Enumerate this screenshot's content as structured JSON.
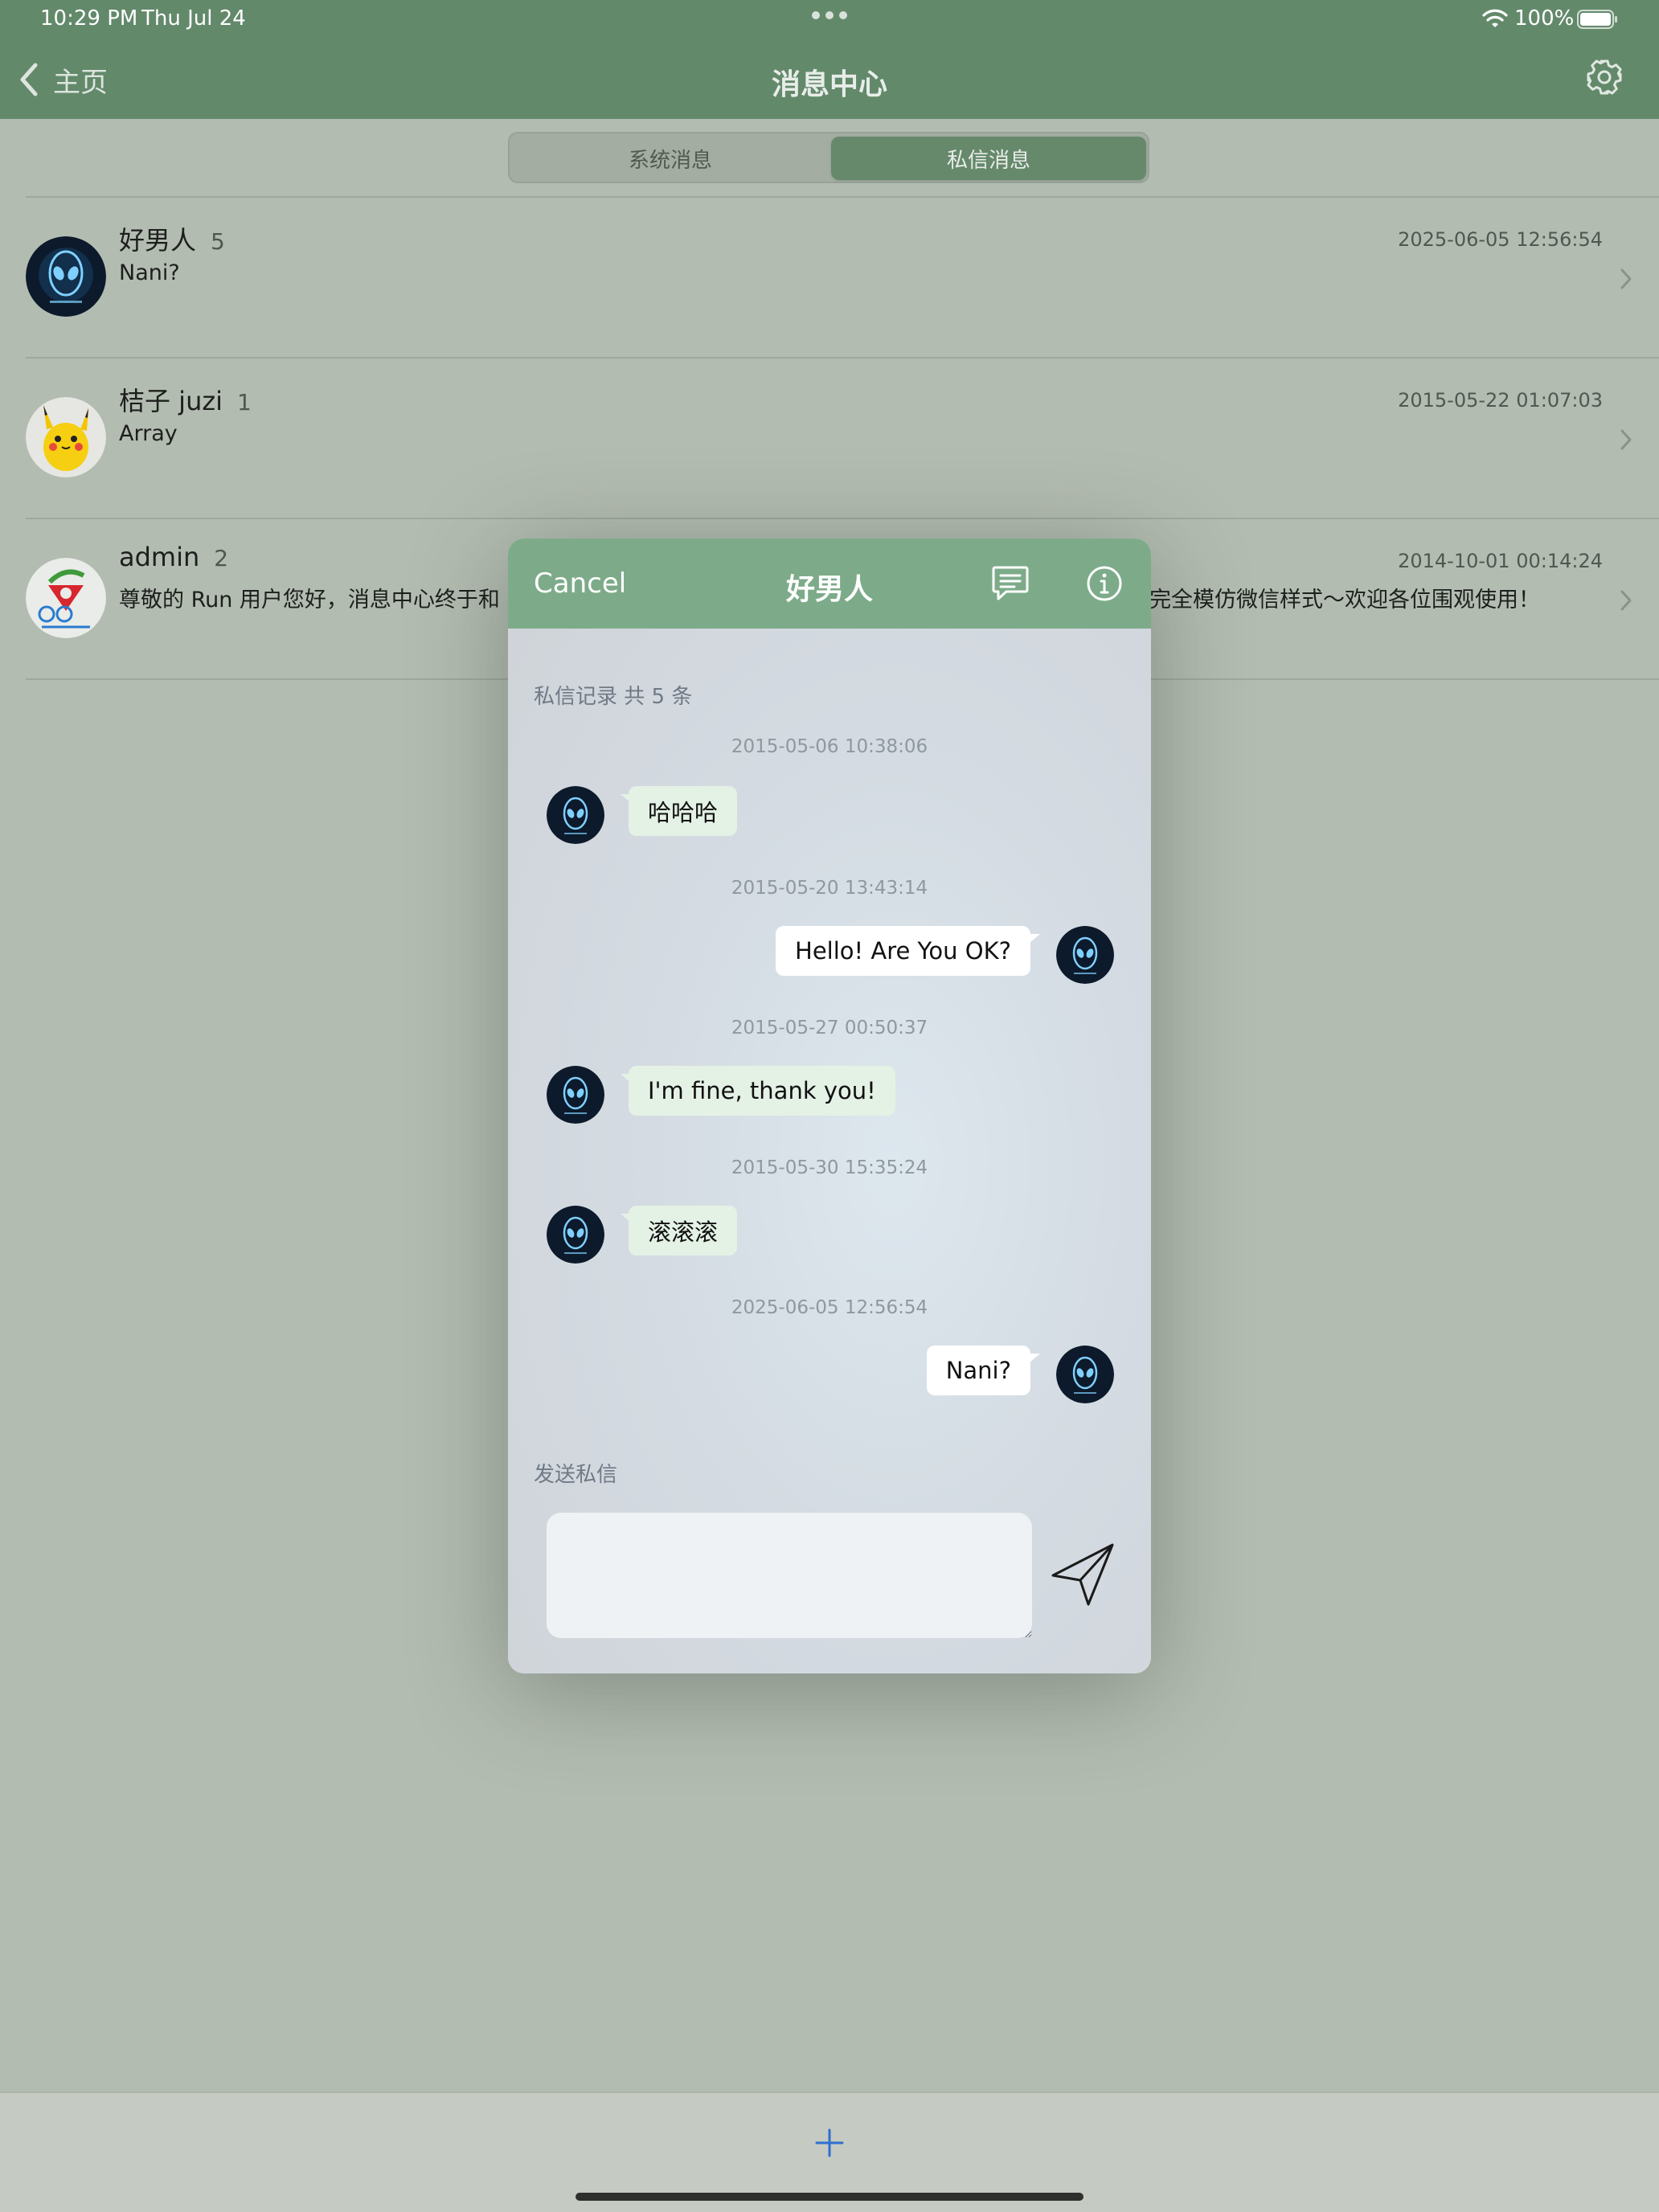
{
  "status_bar": {
    "time": "10:29 PM",
    "date": "Thu Jul 24",
    "battery": "100%"
  },
  "nav": {
    "back_label": "主页",
    "title": "消息中心",
    "settings_icon": "gear-icon"
  },
  "tabs": [
    {
      "label": "系统消息",
      "selected": false
    },
    {
      "label": "私信消息",
      "selected": true
    }
  ],
  "conversations": [
    {
      "name": "好男人",
      "count": "5",
      "preview": "Nani?",
      "time": "2025-06-05 12:56:54",
      "avatar": "alien-avatar"
    },
    {
      "name": "桔子 juzi",
      "count": "1",
      "preview": "Array",
      "time": "2015-05-22 01:07:03",
      "avatar": "pikachu-avatar"
    },
    {
      "name": "admin",
      "count": "2",
      "preview": "尊敬的 Run 用户您好，消息中心终于和",
      "preview_tail": "完全模仿微信样式～欢迎各位围观使用！",
      "time": "2014-10-01 00:14:24",
      "avatar": "capu-logo-avatar"
    }
  ],
  "modal": {
    "cancel_label": "Cancel",
    "title": "好男人",
    "history_label": "私信记录 共 5 条",
    "compose_label": "发送私信",
    "compose_value": "",
    "messages": [
      {
        "time": "2015-05-06 10:38:06",
        "text": "哈哈哈",
        "direction": "in"
      },
      {
        "time": "2015-05-20 13:43:14",
        "text": "Hello! Are You OK?",
        "direction": "out"
      },
      {
        "time": "2015-05-27 00:50:37",
        "text": "I'm fine, thank you!",
        "direction": "in"
      },
      {
        "time": "2015-05-30 15:35:24",
        "text": "滚滚滚",
        "direction": "in"
      },
      {
        "time": "2025-06-05 12:56:54",
        "text": "Nani?",
        "direction": "out"
      }
    ]
  },
  "colors": {
    "nav_green": "#63896b",
    "modal_header_green": "#7dab89",
    "incoming_bubble": "#e4f1e5",
    "outgoing_bubble": "#ffffff"
  }
}
